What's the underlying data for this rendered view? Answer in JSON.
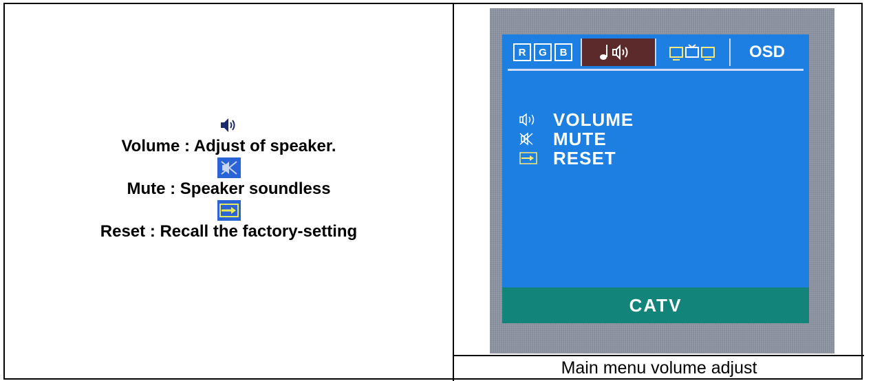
{
  "left": {
    "volume_desc": "Volume : Adjust of speaker.",
    "mute_desc": "Mute : Speaker soundless",
    "reset_desc": "Reset : Recall the factory-setting"
  },
  "osd": {
    "tabs": [
      "RGB",
      "",
      "",
      "OSD"
    ],
    "rgb_letters": [
      "R",
      "G",
      "B"
    ],
    "menu": [
      "VOLUME",
      "MUTE",
      "RESET"
    ],
    "footer": "CATV"
  },
  "caption": "Main menu volume adjust",
  "colors": {
    "osd_bg": "#1e7fe3",
    "active_tab": "#5c2a2a",
    "footer_bar": "#13847a"
  },
  "icons": [
    "speaker-icon",
    "mute-icon",
    "reset-icon",
    "music-note-icon",
    "tv-icon"
  ]
}
